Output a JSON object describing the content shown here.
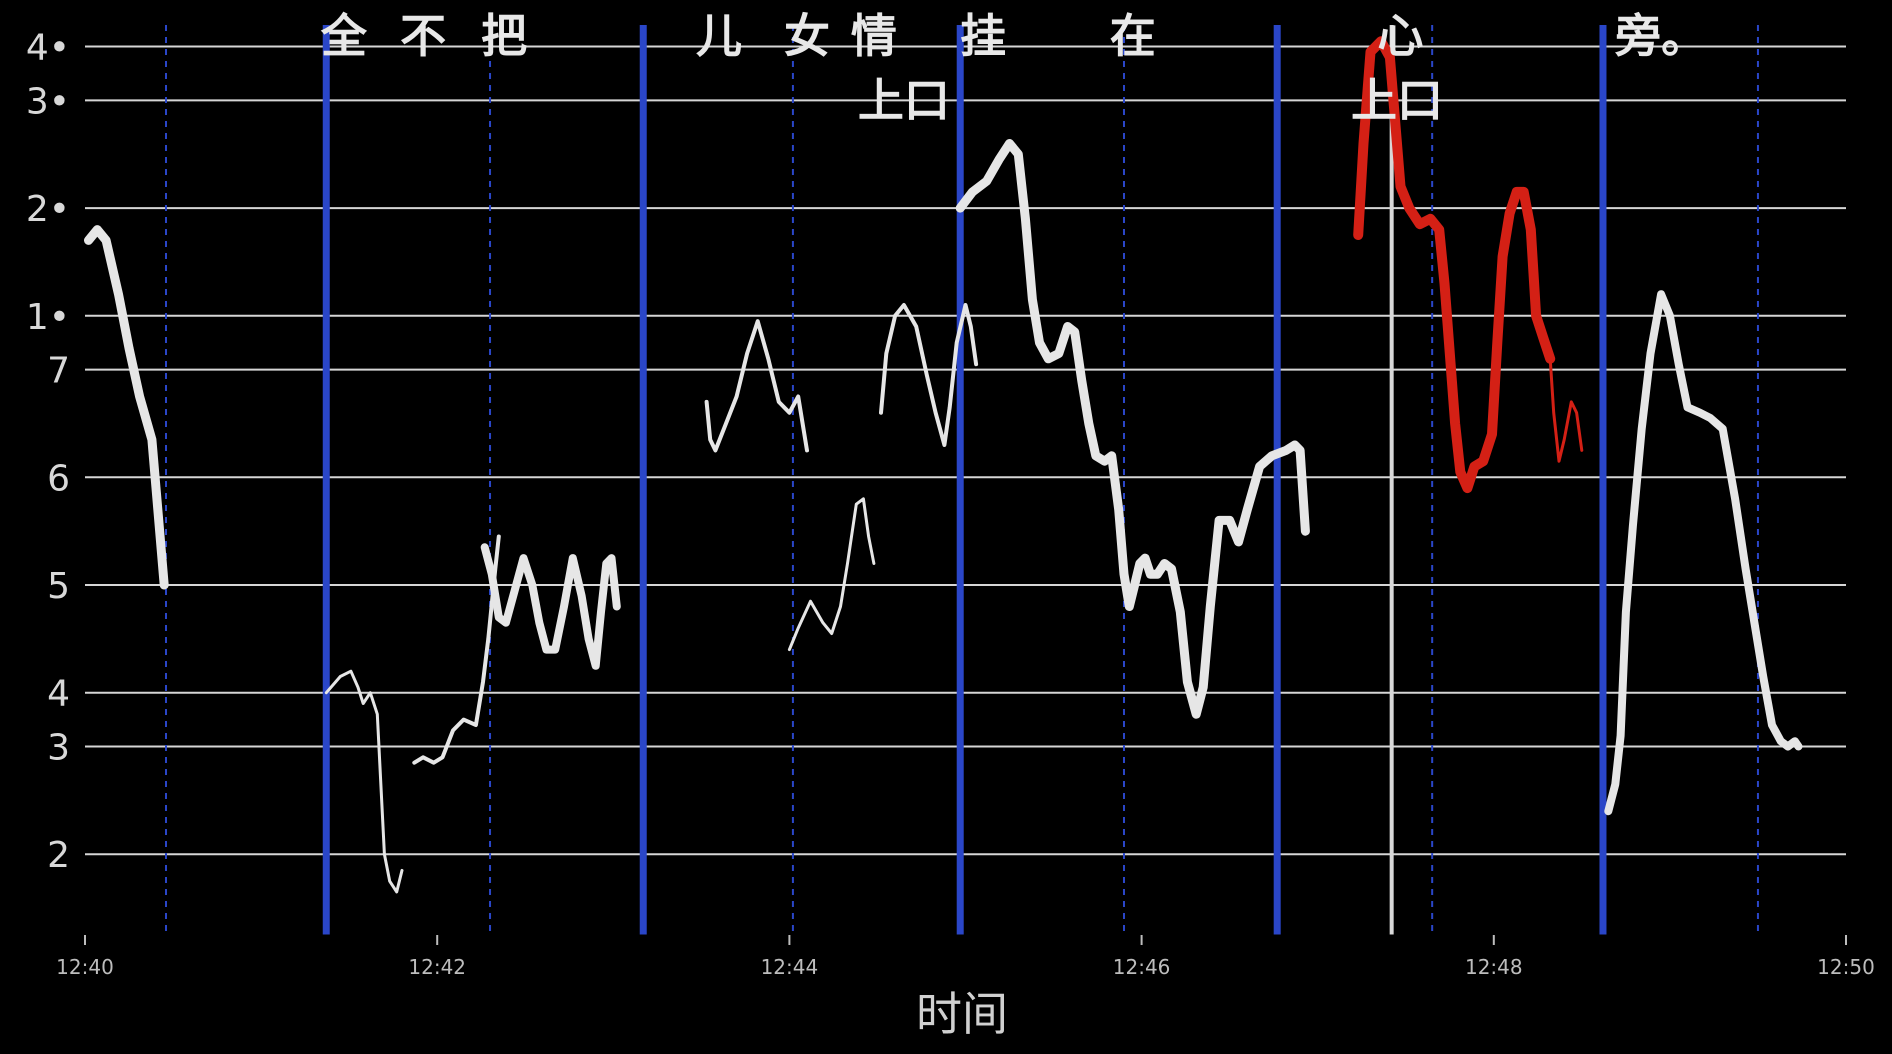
{
  "chart_data": {
    "type": "line",
    "title": "",
    "xlabel": "时间",
    "ylabel": "",
    "x_ticks": [
      "12:40",
      "12:42",
      "12:44",
      "12:46",
      "12:48",
      "12:50"
    ],
    "xlim": [
      0,
      10
    ],
    "y_ticks": [
      {
        "label": "2",
        "value": 0
      },
      {
        "label": "3",
        "value": 2
      },
      {
        "label": "4",
        "value": 3
      },
      {
        "label": "5",
        "value": 5
      },
      {
        "label": "6",
        "value": 7
      },
      {
        "label": "7",
        "value": 9
      },
      {
        "label": "1•",
        "value": 10
      },
      {
        "label": "2•",
        "value": 12
      },
      {
        "label": "3•",
        "value": 14
      },
      {
        "label": "4•",
        "value": 15
      }
    ],
    "ylim": [
      -1.5,
      15.4
    ],
    "grid": true,
    "lyrics": [
      {
        "text": "全",
        "x": 1.47,
        "y": 15.2
      },
      {
        "text": "不",
        "x": 1.92,
        "y": 15.2
      },
      {
        "text": "把",
        "x": 2.38,
        "y": 15.2
      },
      {
        "text": "儿",
        "x": 3.6,
        "y": 15.2
      },
      {
        "text": "女",
        "x": 4.1,
        "y": 15.2
      },
      {
        "text": "情",
        "x": 4.48,
        "y": 15.2
      },
      {
        "text": "挂",
        "x": 5.1,
        "y": 15.2
      },
      {
        "text": "在",
        "x": 5.95,
        "y": 15.2
      },
      {
        "text": "心",
        "x": 7.47,
        "y": 15.2
      },
      {
        "text": "旁。",
        "x": 8.95,
        "y": 15.2
      },
      {
        "text": "上口",
        "x": 4.65,
        "y": 14.0
      },
      {
        "text": "上口",
        "x": 7.45,
        "y": 14.0
      }
    ],
    "markers": {
      "solid": [
        1.37,
        3.17,
        4.97,
        6.77,
        8.62
      ],
      "dashed": [
        0.46,
        2.3,
        4.02,
        5.9,
        7.65,
        9.5
      ],
      "cursor": 7.42
    },
    "series": [
      {
        "color": "#e6e6e6",
        "width": 9,
        "points": [
          [
            0.02,
            11.4
          ],
          [
            0.07,
            11.6
          ],
          [
            0.12,
            11.4
          ],
          [
            0.19,
            10.4
          ],
          [
            0.25,
            9.4
          ],
          [
            0.31,
            8.5
          ],
          [
            0.38,
            7.7
          ],
          [
            0.45,
            5.0
          ]
        ]
      },
      {
        "color": "#e6e6e6",
        "width": 3,
        "points": [
          [
            1.37,
            3.0
          ],
          [
            1.45,
            3.3
          ],
          [
            1.51,
            3.4
          ],
          [
            1.55,
            3.1
          ],
          [
            1.58,
            2.8
          ],
          [
            1.62,
            3.0
          ],
          [
            1.66,
            2.6
          ],
          [
            1.7,
            0.0
          ],
          [
            1.73,
            -0.5
          ],
          [
            1.77,
            -0.7
          ],
          [
            1.8,
            -0.3
          ]
        ]
      },
      {
        "color": "#e6e6e6",
        "width": 4,
        "points": [
          [
            1.87,
            1.7
          ],
          [
            1.92,
            1.8
          ],
          [
            1.98,
            1.7
          ],
          [
            2.03,
            1.8
          ],
          [
            2.09,
            2.3
          ],
          [
            2.15,
            2.5
          ],
          [
            2.22,
            2.4
          ],
          [
            2.26,
            3.2
          ],
          [
            2.29,
            4.0
          ],
          [
            2.33,
            5.3
          ],
          [
            2.35,
            5.9
          ]
        ]
      },
      {
        "color": "#e6e6e6",
        "width": 8,
        "points": [
          [
            2.27,
            5.7
          ],
          [
            2.31,
            5.2
          ],
          [
            2.35,
            4.4
          ],
          [
            2.39,
            4.3
          ],
          [
            2.44,
            4.9
          ],
          [
            2.49,
            5.5
          ],
          [
            2.54,
            5.0
          ],
          [
            2.58,
            4.3
          ],
          [
            2.62,
            3.8
          ],
          [
            2.67,
            3.8
          ],
          [
            2.72,
            4.6
          ],
          [
            2.77,
            5.5
          ],
          [
            2.82,
            4.8
          ],
          [
            2.86,
            4.0
          ],
          [
            2.9,
            3.5
          ],
          [
            2.93,
            4.5
          ],
          [
            2.96,
            5.4
          ],
          [
            2.99,
            5.5
          ],
          [
            3.02,
            4.6
          ]
        ]
      },
      {
        "color": "#e6e6e6",
        "width": 4,
        "points": [
          [
            3.53,
            8.4
          ],
          [
            3.55,
            7.7
          ],
          [
            3.58,
            7.5
          ],
          [
            3.64,
            8.0
          ],
          [
            3.7,
            8.5
          ],
          [
            3.76,
            9.3
          ],
          [
            3.82,
            9.9
          ],
          [
            3.88,
            9.2
          ],
          [
            3.94,
            8.4
          ],
          [
            4.0,
            8.2
          ],
          [
            4.05,
            8.5
          ],
          [
            4.1,
            7.5
          ]
        ]
      },
      {
        "color": "#e6e6e6",
        "width": 3,
        "points": [
          [
            4.0,
            3.8
          ],
          [
            4.05,
            4.2
          ],
          [
            4.12,
            4.7
          ],
          [
            4.19,
            4.3
          ],
          [
            4.24,
            4.1
          ],
          [
            4.29,
            4.6
          ],
          [
            4.33,
            5.4
          ],
          [
            4.38,
            6.5
          ],
          [
            4.42,
            6.6
          ],
          [
            4.45,
            5.9
          ],
          [
            4.48,
            5.4
          ]
        ]
      },
      {
        "color": "#e6e6e6",
        "width": 4,
        "points": [
          [
            4.52,
            8.2
          ],
          [
            4.55,
            9.3
          ],
          [
            4.6,
            10.0
          ],
          [
            4.65,
            10.2
          ],
          [
            4.72,
            9.8
          ],
          [
            4.78,
            8.9
          ],
          [
            4.83,
            8.2
          ],
          [
            4.88,
            7.6
          ],
          [
            4.91,
            8.3
          ],
          [
            4.95,
            9.5
          ],
          [
            5.0,
            10.2
          ],
          [
            5.03,
            9.8
          ],
          [
            5.06,
            9.1
          ]
        ]
      },
      {
        "color": "#e6e6e6",
        "width": 9,
        "points": [
          [
            4.97,
            12.0
          ],
          [
            5.04,
            12.3
          ],
          [
            5.12,
            12.5
          ],
          [
            5.19,
            12.9
          ],
          [
            5.25,
            13.2
          ],
          [
            5.3,
            13.0
          ],
          [
            5.34,
            11.8
          ],
          [
            5.38,
            10.3
          ],
          [
            5.42,
            9.5
          ],
          [
            5.47,
            9.2
          ],
          [
            5.53,
            9.3
          ],
          [
            5.58,
            9.8
          ],
          [
            5.62,
            9.7
          ],
          [
            5.66,
            8.8
          ],
          [
            5.7,
            8.0
          ],
          [
            5.74,
            7.4
          ],
          [
            5.79,
            7.3
          ],
          [
            5.83,
            7.4
          ],
          [
            5.87,
            6.4
          ],
          [
            5.9,
            5.2
          ],
          [
            5.93,
            4.6
          ],
          [
            5.96,
            5.0
          ],
          [
            5.99,
            5.4
          ],
          [
            6.02,
            5.5
          ],
          [
            6.05,
            5.2
          ],
          [
            6.09,
            5.2
          ],
          [
            6.13,
            5.4
          ],
          [
            6.17,
            5.3
          ],
          [
            6.22,
            4.5
          ],
          [
            6.26,
            3.2
          ],
          [
            6.31,
            2.6
          ],
          [
            6.35,
            3.1
          ],
          [
            6.39,
            4.6
          ],
          [
            6.44,
            6.2
          ],
          [
            6.5,
            6.2
          ],
          [
            6.55,
            5.8
          ],
          [
            6.6,
            6.4
          ],
          [
            6.67,
            7.2
          ],
          [
            6.74,
            7.4
          ],
          [
            6.82,
            7.5
          ],
          [
            6.87,
            7.6
          ],
          [
            6.9,
            7.5
          ],
          [
            6.93,
            6.0
          ]
        ]
      },
      {
        "color": "#d42015",
        "width": 10,
        "points": [
          [
            7.23,
            11.5
          ],
          [
            7.26,
            13.2
          ],
          [
            7.3,
            14.9
          ],
          [
            7.36,
            15.1
          ],
          [
            7.41,
            14.8
          ],
          [
            7.44,
            13.6
          ],
          [
            7.47,
            12.4
          ],
          [
            7.52,
            12.0
          ],
          [
            7.58,
            11.7
          ],
          [
            7.64,
            11.8
          ],
          [
            7.69,
            11.6
          ],
          [
            7.72,
            10.6
          ],
          [
            7.75,
            9.3
          ],
          [
            7.78,
            8.0
          ],
          [
            7.81,
            7.1
          ],
          [
            7.85,
            6.8
          ],
          [
            7.89,
            7.2
          ],
          [
            7.94,
            7.3
          ],
          [
            7.99,
            7.8
          ],
          [
            8.02,
            9.5
          ],
          [
            8.05,
            11.1
          ],
          [
            8.09,
            11.9
          ],
          [
            8.13,
            12.3
          ],
          [
            8.17,
            12.3
          ],
          [
            8.21,
            11.6
          ],
          [
            8.24,
            10.0
          ],
          [
            8.28,
            9.6
          ],
          [
            8.32,
            9.2
          ]
        ]
      },
      {
        "color": "#d42015",
        "width": 3,
        "points": [
          [
            8.32,
            9.2
          ],
          [
            8.34,
            8.2
          ],
          [
            8.37,
            7.3
          ],
          [
            8.4,
            7.7
          ],
          [
            8.44,
            8.4
          ],
          [
            8.47,
            8.2
          ],
          [
            8.5,
            7.5
          ]
        ]
      },
      {
        "color": "#e6e6e6",
        "width": 8,
        "points": [
          [
            8.65,
            0.8
          ],
          [
            8.69,
            1.3
          ],
          [
            8.72,
            2.2
          ],
          [
            8.75,
            4.5
          ],
          [
            8.79,
            6.1
          ],
          [
            8.84,
            7.9
          ],
          [
            8.89,
            9.3
          ],
          [
            8.95,
            10.4
          ],
          [
            9.0,
            10.0
          ],
          [
            9.05,
            9.1
          ],
          [
            9.1,
            8.3
          ],
          [
            9.17,
            8.2
          ],
          [
            9.23,
            8.1
          ],
          [
            9.3,
            7.9
          ],
          [
            9.37,
            6.6
          ],
          [
            9.43,
            5.3
          ],
          [
            9.48,
            4.3
          ],
          [
            9.53,
            3.3
          ],
          [
            9.58,
            2.4
          ],
          [
            9.63,
            2.1
          ],
          [
            9.67,
            2.0
          ],
          [
            9.71,
            2.1
          ],
          [
            9.73,
            2.0
          ]
        ]
      }
    ]
  }
}
